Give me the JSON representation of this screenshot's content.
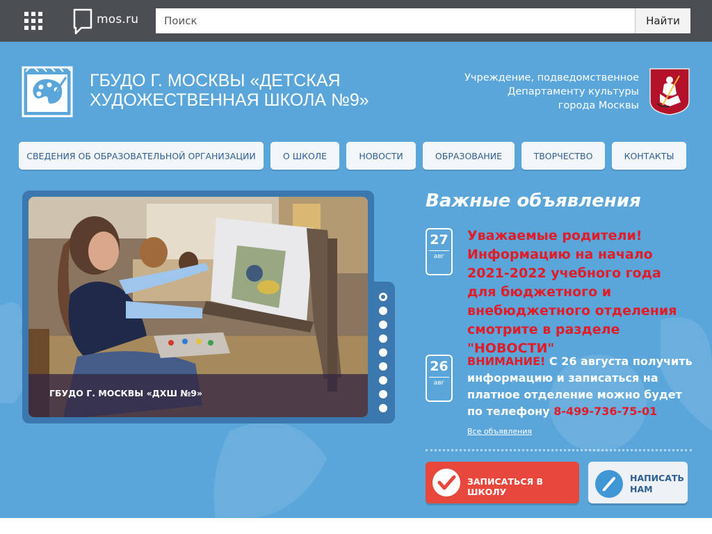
{
  "topbar": {
    "apps_icon": "grid-icon",
    "logo_text": "mos.ru",
    "search_placeholder": "Поиск",
    "search_button": "Найти"
  },
  "header": {
    "school_title": "ГБУДО Г. МОСКВЫ «ДЕТСКАЯ ХУДОЖЕСТВЕННАЯ ШКОЛА №9»",
    "subordinate_lines": [
      "Учреждение, подведомственное",
      "Департаменту культуры",
      "города Москвы"
    ]
  },
  "nav": [
    {
      "label": "СВЕДЕНИЯ ОБ ОБРАЗОВАТЕЛЬНОЙ ОРГАНИЗАЦИИ"
    },
    {
      "label": "О ШКОЛЕ"
    },
    {
      "label": "НОВОСТИ"
    },
    {
      "label": "ОБРАЗОВАНИЕ"
    },
    {
      "label": "ТВОРЧЕСТВО"
    },
    {
      "label": "КОНТАКТЫ"
    }
  ],
  "slider": {
    "caption": "ГБУДО Г. МОСКВЫ «ДХШ №9»",
    "dot_count": 9,
    "active_dot": 1
  },
  "announcements": {
    "title": "Важные объявления",
    "items": [
      {
        "day": "27",
        "month": "авг",
        "text": "Уважаемые родители! Информацию на начало 2021-2022 учебного года для бюджетного и внебюджетного отделения  смотрите в разделе \"НОВОСТИ\""
      },
      {
        "day": "26",
        "month": "авг",
        "prefix": "ВНИМАНИЕ!",
        "text": " С 26 августа получить информацию и записаться на платное отделение можно будет по телефону ",
        "phone": "8-499-736-75-01"
      }
    ],
    "all_link": "Все объявления"
  },
  "actions": {
    "enroll": "ЗАПИСАТЬСЯ В ШКОЛУ",
    "write_line1": "НАПИСАТЬ",
    "write_line2": "НАМ"
  },
  "colors": {
    "topbar": "#4b4f53",
    "main_bg": "#5aa6db",
    "accent_red": "#e21b27",
    "nav_text": "#2d5f92"
  }
}
